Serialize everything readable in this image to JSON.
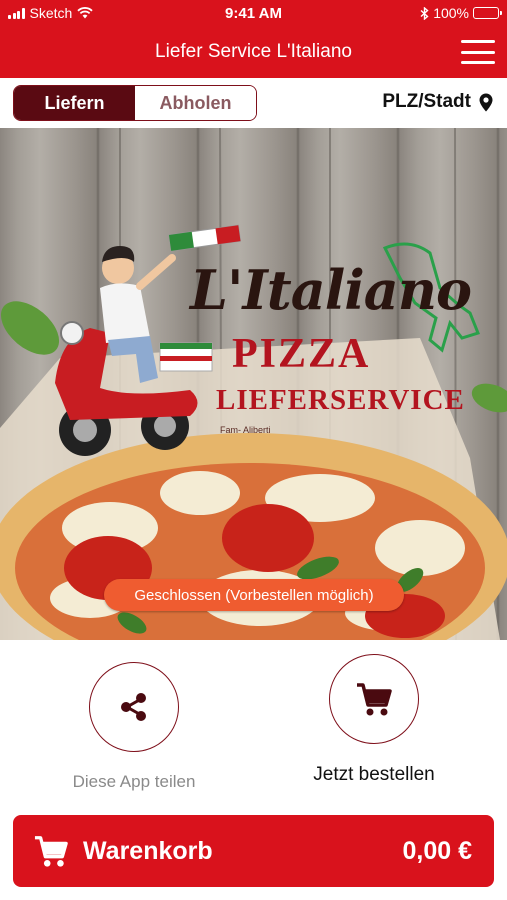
{
  "status_bar": {
    "carrier": "Sketch",
    "time": "9:41 AM",
    "battery": "100%"
  },
  "nav": {
    "title": "Liefer Service L'Italiano",
    "menu_icon": "hamburger-menu-icon"
  },
  "mode_toggle": {
    "delivery_label": "Liefern",
    "pickup_label": "Abholen",
    "active": "Liefern"
  },
  "location": {
    "label": "PLZ/Stadt",
    "icon": "location-pin-icon"
  },
  "hero": {
    "logo_line1": "L'Italiano",
    "logo_line2": "PIZZA",
    "logo_line3": "LIEFERSERVICE",
    "logo_line4": "Fam- Aliberti",
    "status": "Geschlossen (Vorbestellen möglich)"
  },
  "actions": {
    "share_label": "Diese App teilen",
    "order_label": "Jetzt bestellen",
    "share_icon": "share-icon",
    "order_icon": "cart-icon"
  },
  "cart": {
    "label": "Warenkorb",
    "total": "0,00 €"
  },
  "colors": {
    "brand_red": "#d9121c",
    "dark_red": "#5a0a12",
    "status_orange": "#ef5c30"
  }
}
